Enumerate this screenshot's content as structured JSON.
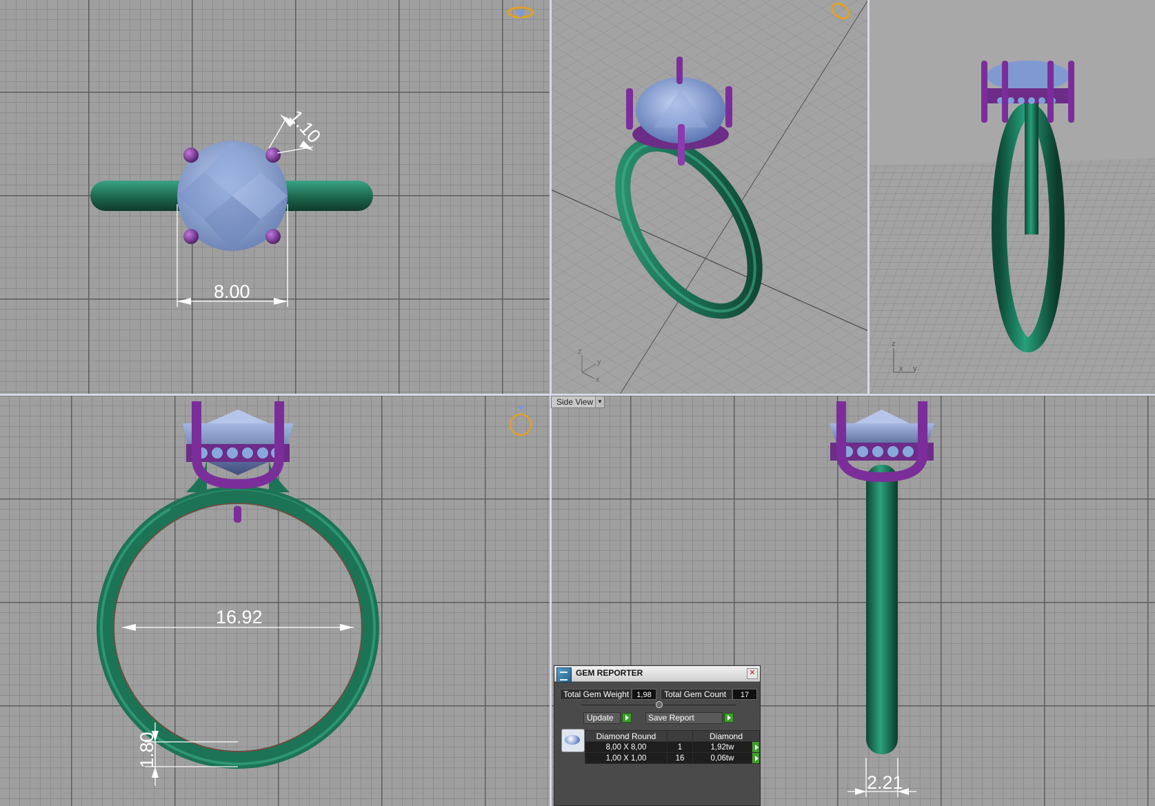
{
  "viewports": {
    "top": {
      "dimensions": [
        "8.00",
        "1.10"
      ]
    },
    "front": {
      "dimensions": [
        "16.92",
        "1.80"
      ]
    },
    "side": {
      "dropdown_label": "Side View",
      "dimensions": [
        "2.21"
      ]
    },
    "perspective": {
      "axis_labels": [
        "z",
        "y",
        "x"
      ]
    },
    "right3d": {
      "axis_labels": [
        "z",
        "x",
        "y"
      ]
    }
  },
  "gem_reporter": {
    "title": "GEM REPORTER",
    "total_weight_label": "Total Gem Weight",
    "total_weight_value": "1,98",
    "total_count_label": "Total Gem Count",
    "total_count_value": "17",
    "update_label": "Update",
    "save_report_label": "Save Report",
    "columns": [
      "Diamond Round",
      "",
      "Diamond"
    ],
    "rows": [
      [
        "8,00 X 8,00",
        "1",
        "1,92tw"
      ],
      [
        "1,00 X 1,00",
        "16",
        "0,06tw"
      ]
    ]
  },
  "colors": {
    "metal": "#1f7a5a",
    "prong": "#7b2e9a",
    "gem": "#8fa7d9",
    "grid_bg": "#9f9f9f",
    "view_icon": "#e0a12a"
  }
}
